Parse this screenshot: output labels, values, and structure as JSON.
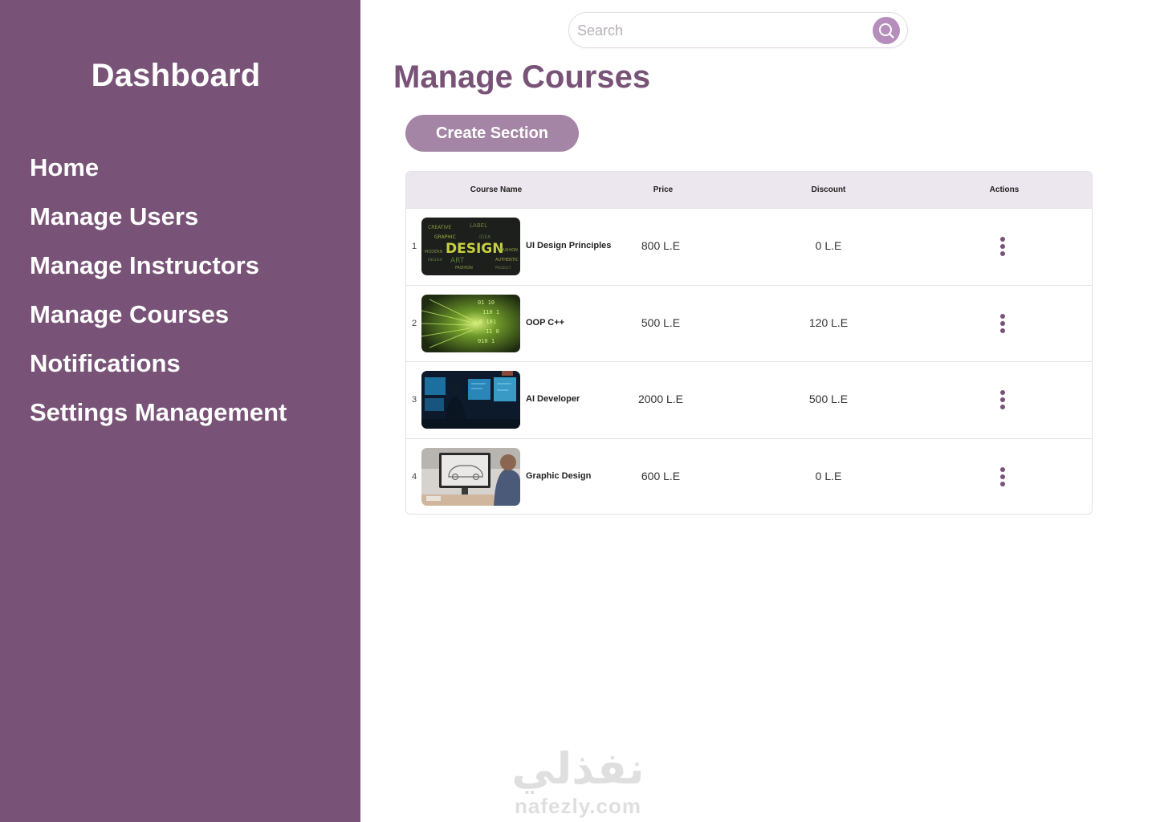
{
  "sidebar": {
    "title": "Dashboard",
    "items": [
      {
        "label": "Home"
      },
      {
        "label": "Manage Users"
      },
      {
        "label": "Manage Instructors"
      },
      {
        "label": "Manage Courses"
      },
      {
        "label": "Notifications"
      },
      {
        "label": "Settings Management"
      }
    ]
  },
  "search": {
    "placeholder": "Search",
    "icon": "search-icon"
  },
  "page": {
    "title": "Manage Courses"
  },
  "actions": {
    "create_label": "Create Section"
  },
  "table": {
    "headers": {
      "name": "Course Name",
      "price": "Price",
      "discount": "Discount",
      "actions": "Actions"
    },
    "rows": [
      {
        "index": "1",
        "name": "UI Design Principles",
        "price": "800 L.E",
        "discount": "0 L.E",
        "thumbnail": "design-word-cloud"
      },
      {
        "index": "2",
        "name": "OOP C++",
        "price": "500 L.E",
        "discount": "120 L.E",
        "thumbnail": "green-code-streams"
      },
      {
        "index": "3",
        "name": "AI Developer",
        "price": "2000 L.E",
        "discount": "500 L.E",
        "thumbnail": "developer-at-monitors"
      },
      {
        "index": "4",
        "name": "Graphic Design",
        "price": "600 L.E",
        "discount": "0 L.E",
        "thumbnail": "car-sketch-on-monitor"
      }
    ]
  },
  "colors": {
    "sidebar_bg": "#785377",
    "accent": "#785377",
    "button_bg": "#a585a6",
    "search_button_bg": "#b58ebb",
    "table_header_bg": "#ece6ee"
  },
  "watermark": {
    "arabic": "نفذلي",
    "latin": "nafezly.com"
  }
}
